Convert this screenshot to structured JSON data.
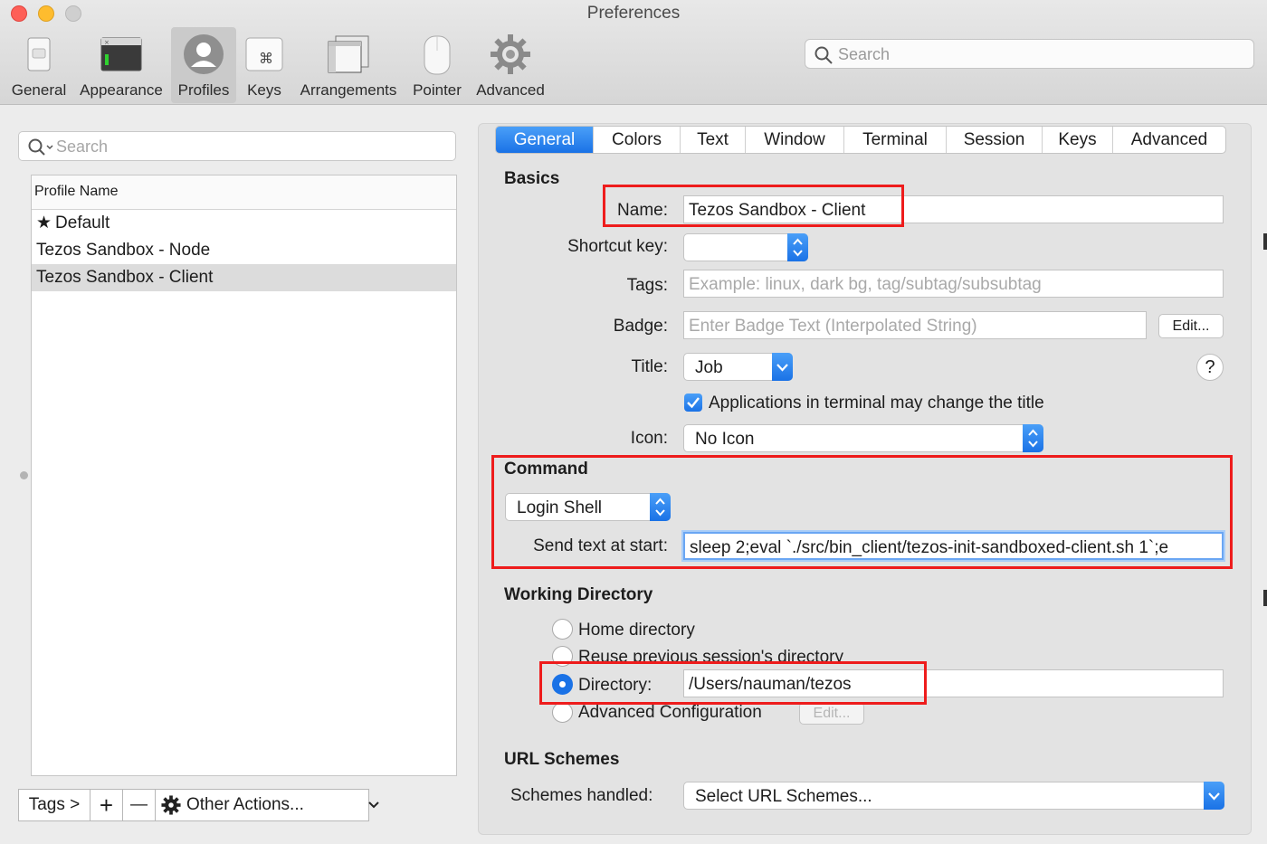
{
  "window": {
    "title": "Preferences"
  },
  "toolbar": {
    "items": [
      {
        "label": "General",
        "icon": "general-switch-icon"
      },
      {
        "label": "Appearance",
        "icon": "appearance-window-icon"
      },
      {
        "label": "Profiles",
        "icon": "profiles-person-icon",
        "selected": true
      },
      {
        "label": "Keys",
        "icon": "command-key-icon"
      },
      {
        "label": "Arrangements",
        "icon": "arrangements-windows-icon"
      },
      {
        "label": "Pointer",
        "icon": "mouse-icon"
      },
      {
        "label": "Advanced",
        "icon": "gear-icon"
      }
    ],
    "search_placeholder": "Search"
  },
  "profiles": {
    "search_placeholder": "Search",
    "column_header": "Profile Name",
    "rows": [
      {
        "name": "Default",
        "default": true
      },
      {
        "name": "Tezos Sandbox - Node"
      },
      {
        "name": "Tezos Sandbox - Client",
        "selected": true
      }
    ],
    "bottom_bar": {
      "tags": "Tags >",
      "add": "+",
      "remove": "—",
      "other_actions": "Other Actions..."
    }
  },
  "tabs": [
    "General",
    "Colors",
    "Text",
    "Window",
    "Terminal",
    "Session",
    "Keys",
    "Advanced"
  ],
  "active_tab": "General",
  "basics": {
    "heading": "Basics",
    "name_label": "Name:",
    "name_value": "Tezos Sandbox - Client",
    "shortcut_label": "Shortcut key:",
    "shortcut_value": "",
    "tags_label": "Tags:",
    "tags_placeholder": "Example: linux, dark bg, tag/subtag/subsubtag",
    "badge_label": "Badge:",
    "badge_placeholder": "Enter Badge Text (Interpolated String)",
    "badge_edit": "Edit...",
    "title_label": "Title:",
    "title_value": "Job",
    "help": "?",
    "apps_change_title": "Applications in terminal may change the title",
    "apps_change_title_checked": true,
    "icon_label": "Icon:",
    "icon_value": "No Icon"
  },
  "command": {
    "heading": "Command",
    "shell_value": "Login Shell",
    "send_text_label": "Send text at start:",
    "send_text_value": "sleep 2;eval `./src/bin_client/tezos-init-sandboxed-client.sh 1`;e"
  },
  "working_directory": {
    "heading": "Working Directory",
    "home": "Home directory",
    "reuse": "Reuse previous session's directory",
    "directory": "Directory:",
    "directory_value": "/Users/nauman/tezos",
    "advanced": "Advanced Configuration",
    "advanced_edit": "Edit...",
    "selected": "directory"
  },
  "url_schemes": {
    "heading": "URL Schemes",
    "label": "Schemes handled:",
    "value": "Select URL Schemes..."
  },
  "colors": {
    "accent": "#1a72e6",
    "highlight_box": "#ee1c1c"
  }
}
